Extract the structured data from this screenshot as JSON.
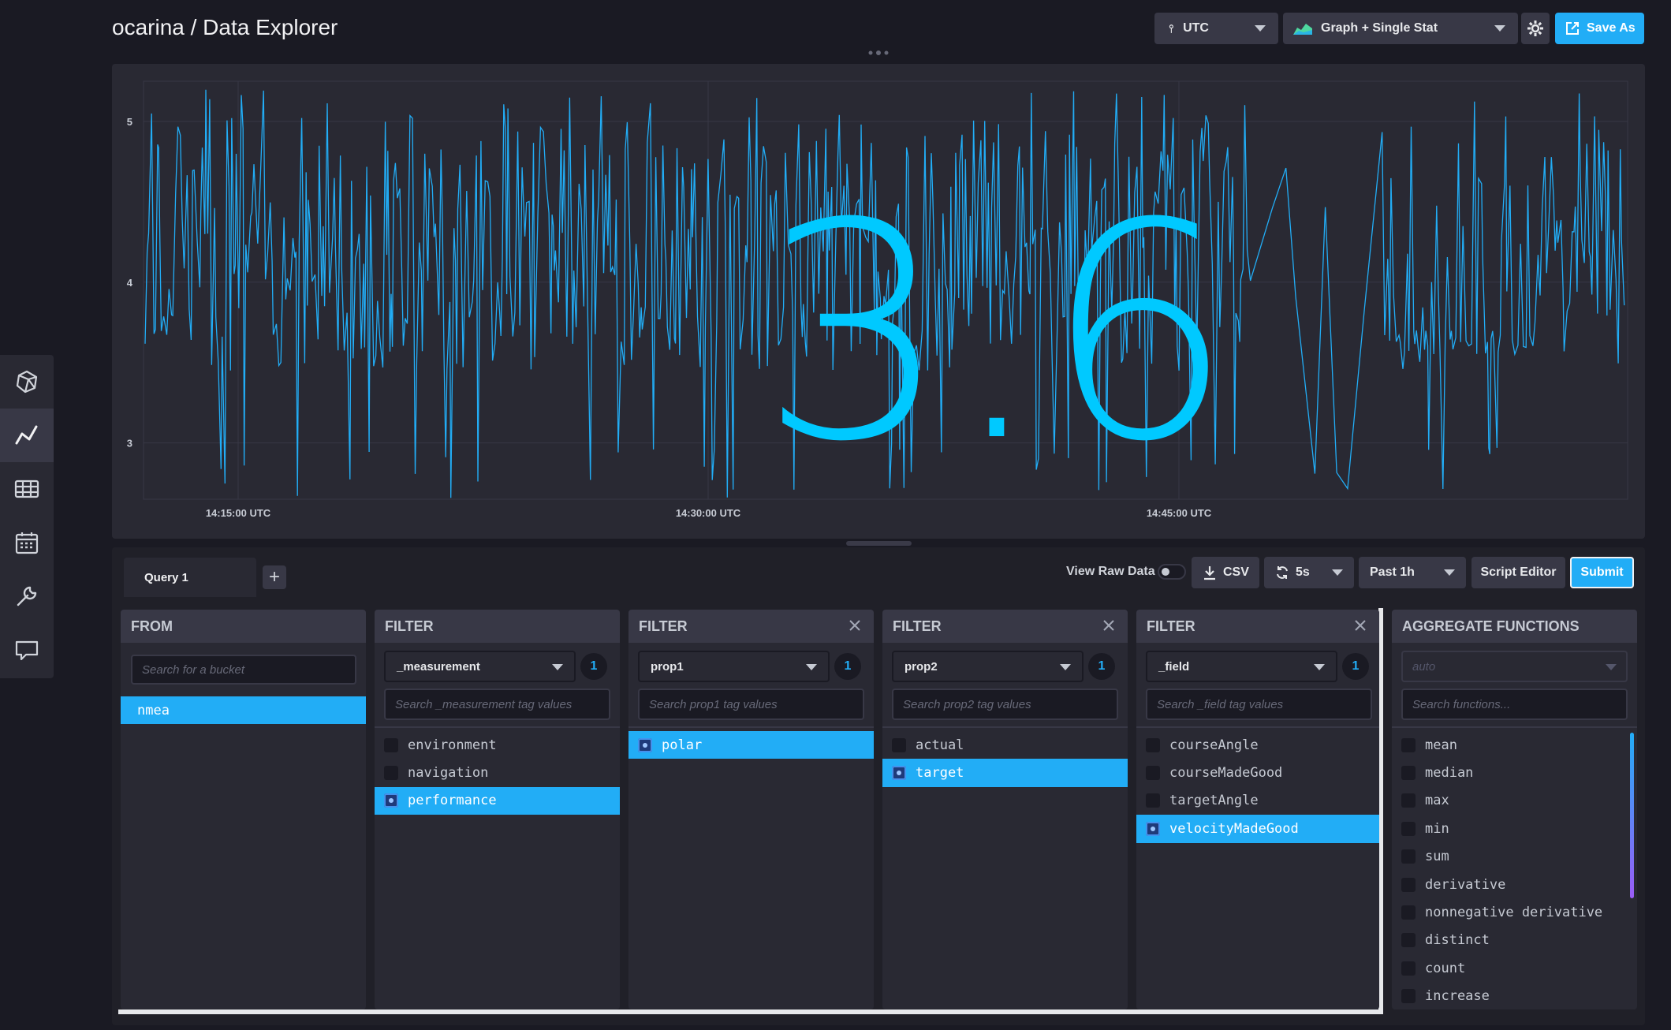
{
  "header": {
    "title": "ocarina / Data Explorer",
    "timezone": "UTC",
    "viz_type": "Graph + Single Stat",
    "save_label": "Save As"
  },
  "graph": {
    "single_stat": "3.6",
    "y_ticks": [
      "5",
      "4",
      "3"
    ],
    "x_ticks": [
      "14:15:00 UTC",
      "14:30:00 UTC",
      "14:45:00 UTC"
    ],
    "line_color": "#22adf6",
    "stat_color": "#00c9ff"
  },
  "chart_data": {
    "type": "line",
    "ylim": [
      2.65,
      5.25
    ],
    "x_ticks": [
      "14:15:00 UTC",
      "14:30:00 UTC",
      "14:45:00 UTC"
    ],
    "y_ticks": [
      3,
      4,
      5
    ],
    "series": [
      {
        "values_range": [
          2.65,
          5.25
        ]
      }
    ],
    "grid": true
  },
  "toolbar": {
    "query_tab": "Query 1",
    "add_query": "+",
    "view_raw": "View Raw Data",
    "csv": "CSV",
    "refresh": "5s",
    "range": "Past 1h",
    "script_editor": "Script Editor",
    "submit": "Submit"
  },
  "from": {
    "title": "FROM",
    "search": "Search for a bucket",
    "items": [
      {
        "label": "nmea",
        "selected": true
      }
    ]
  },
  "filters": [
    {
      "title": "FILTER",
      "key": "_measurement",
      "count": "1",
      "search": "Search _measurement tag values",
      "items": [
        {
          "label": "environment",
          "selected": false
        },
        {
          "label": "navigation",
          "selected": false
        },
        {
          "label": "performance",
          "selected": true
        }
      ]
    },
    {
      "title": "FILTER",
      "key": "prop1",
      "count": "1",
      "search": "Search prop1 tag values",
      "items": [
        {
          "label": "polar",
          "selected": true
        }
      ]
    },
    {
      "title": "FILTER",
      "key": "prop2",
      "count": "1",
      "search": "Search prop2 tag values",
      "items": [
        {
          "label": "actual",
          "selected": false
        },
        {
          "label": "target",
          "selected": true
        }
      ]
    },
    {
      "title": "FILTER",
      "key": "_field",
      "count": "1",
      "search": "Search _field tag values",
      "items": [
        {
          "label": "courseAngle",
          "selected": false
        },
        {
          "label": "courseMadeGood",
          "selected": false
        },
        {
          "label": "targetAngle",
          "selected": false
        },
        {
          "label": "velocityMadeGood",
          "selected": true
        }
      ]
    }
  ],
  "aggregate": {
    "title": "AGGREGATE FUNCTIONS",
    "window": "auto",
    "search": "Search functions...",
    "items": [
      "mean",
      "median",
      "max",
      "min",
      "sum",
      "derivative",
      "nonnegative derivative",
      "distinct",
      "count",
      "increase"
    ]
  }
}
